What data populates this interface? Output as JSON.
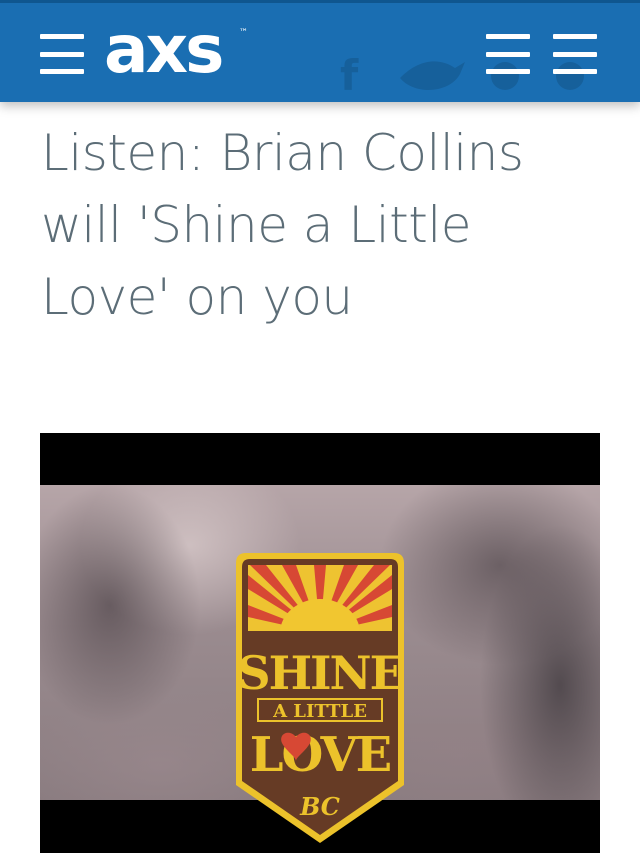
{
  "header": {
    "logo_text": "axs",
    "logo_tm": "™",
    "background_color": "#1a6eb2"
  },
  "article": {
    "title": "Listen: Brian Collins will 'Shine a Little Love' on you"
  },
  "video": {
    "artwork": {
      "line1": "SHINE",
      "line2": "A LITTLE",
      "line3": "LOVE",
      "monogram": "BC"
    }
  }
}
